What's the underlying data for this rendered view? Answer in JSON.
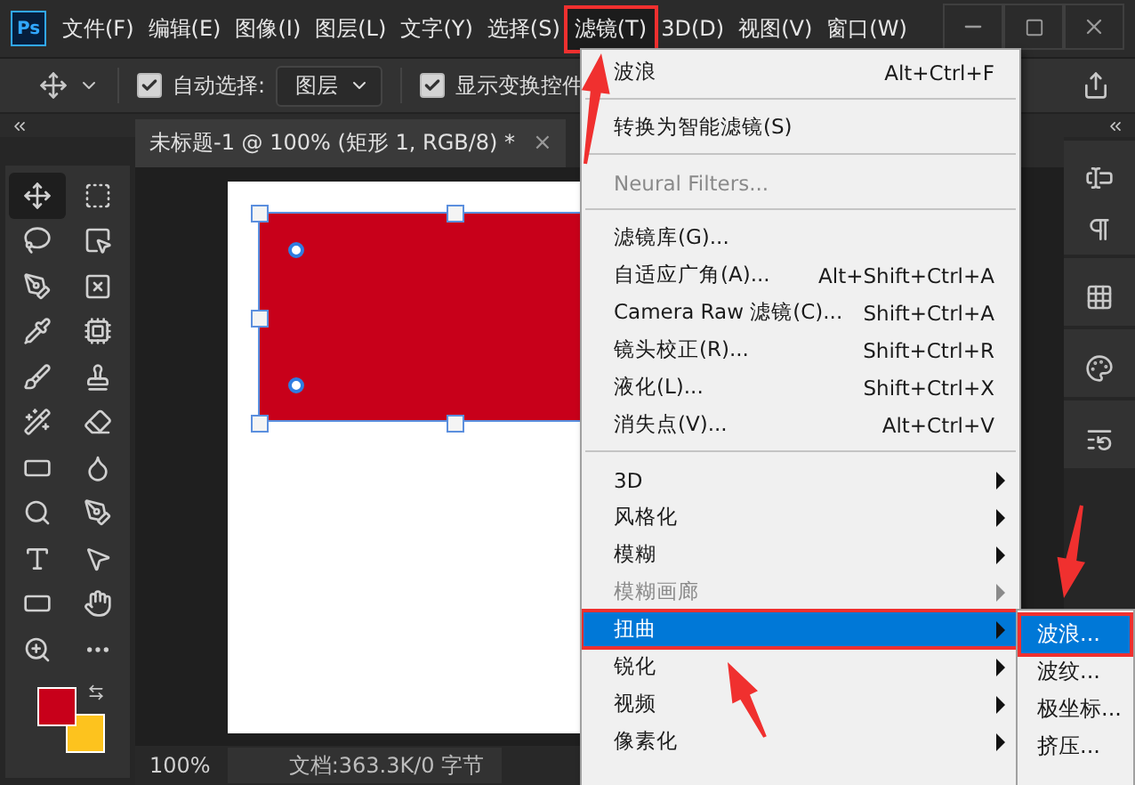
{
  "app": {
    "logo": "Ps"
  },
  "menu_bar": [
    {
      "label": "文件(F)",
      "selected": false,
      "annotated": false
    },
    {
      "label": "编辑(E)",
      "selected": false,
      "annotated": false
    },
    {
      "label": "图像(I)",
      "selected": false,
      "annotated": false
    },
    {
      "label": "图层(L)",
      "selected": false,
      "annotated": false
    },
    {
      "label": "文字(Y)",
      "selected": false,
      "annotated": false
    },
    {
      "label": "选择(S)",
      "selected": false,
      "annotated": false
    },
    {
      "label": "滤镜(T)",
      "selected": true,
      "annotated": true
    },
    {
      "label": "3D(D)",
      "selected": false,
      "annotated": false
    },
    {
      "label": "视图(V)",
      "selected": false,
      "annotated": false
    },
    {
      "label": "窗口(W)",
      "selected": false,
      "annotated": false
    }
  ],
  "options_bar": {
    "auto_select": {
      "label": "自动选择:",
      "checked": true
    },
    "target_dropdown": {
      "value": "图层"
    },
    "show_transform": {
      "label": "显示变换控件",
      "checked": true
    }
  },
  "document_tab": {
    "title": "未标题-1 @ 100% (矩形 1, RGB/8) *",
    "close": "×"
  },
  "status_bar": {
    "zoom": "100%",
    "doc_info": "文档:363.3K/0 字节"
  },
  "filter_menu": {
    "items": [
      {
        "kind": "item",
        "label": "波浪",
        "shortcut": "Alt+Ctrl+F",
        "disabled": false,
        "selected": false,
        "annotated": false,
        "submenu": false
      },
      {
        "kind": "separator"
      },
      {
        "kind": "item",
        "label": "转换为智能滤镜(S)",
        "disabled": false,
        "selected": false,
        "annotated": false,
        "submenu": false
      },
      {
        "kind": "separator"
      },
      {
        "kind": "item",
        "label": "Neural Filters...",
        "disabled": true,
        "selected": false,
        "annotated": false,
        "submenu": false
      },
      {
        "kind": "separator"
      },
      {
        "kind": "item",
        "label": "滤镜库(G)...",
        "disabled": false,
        "selected": false,
        "annotated": false,
        "submenu": false
      },
      {
        "kind": "item",
        "label": "自适应广角(A)...",
        "shortcut": "Alt+Shift+Ctrl+A",
        "disabled": false,
        "selected": false,
        "annotated": false,
        "submenu": false
      },
      {
        "kind": "item",
        "label": "Camera Raw 滤镜(C)...",
        "shortcut": "Shift+Ctrl+A",
        "disabled": false,
        "selected": false,
        "annotated": false,
        "submenu": false
      },
      {
        "kind": "item",
        "label": "镜头校正(R)...",
        "shortcut": "Shift+Ctrl+R",
        "disabled": false,
        "selected": false,
        "annotated": false,
        "submenu": false
      },
      {
        "kind": "item",
        "label": "液化(L)...",
        "shortcut": "Shift+Ctrl+X",
        "disabled": false,
        "selected": false,
        "annotated": false,
        "submenu": false
      },
      {
        "kind": "item",
        "label": "消失点(V)...",
        "shortcut": "Alt+Ctrl+V",
        "disabled": false,
        "selected": false,
        "annotated": false,
        "submenu": false
      },
      {
        "kind": "separator"
      },
      {
        "kind": "item",
        "label": "3D",
        "disabled": false,
        "selected": false,
        "annotated": false,
        "submenu": true
      },
      {
        "kind": "item",
        "label": "风格化",
        "disabled": false,
        "selected": false,
        "annotated": false,
        "submenu": true
      },
      {
        "kind": "item",
        "label": "模糊",
        "disabled": false,
        "selected": false,
        "annotated": false,
        "submenu": true
      },
      {
        "kind": "item",
        "label": "模糊画廊",
        "disabled": true,
        "selected": false,
        "annotated": false,
        "submenu": true
      },
      {
        "kind": "item",
        "label": "扭曲",
        "disabled": false,
        "selected": true,
        "annotated": true,
        "submenu": true
      },
      {
        "kind": "item",
        "label": "锐化",
        "disabled": false,
        "selected": false,
        "annotated": false,
        "submenu": true
      },
      {
        "kind": "item",
        "label": "视频",
        "disabled": false,
        "selected": false,
        "annotated": false,
        "submenu": true
      },
      {
        "kind": "item",
        "label": "像素化",
        "disabled": false,
        "selected": false,
        "annotated": false,
        "submenu": true
      }
    ]
  },
  "distort_submenu": {
    "items": [
      {
        "label": "波浪...",
        "selected": true,
        "annotated": true
      },
      {
        "label": "波纹...",
        "selected": false,
        "annotated": false
      },
      {
        "label": "极坐标...",
        "selected": false,
        "annotated": false
      },
      {
        "label": "挤压...",
        "selected": false,
        "annotated": false
      }
    ]
  }
}
